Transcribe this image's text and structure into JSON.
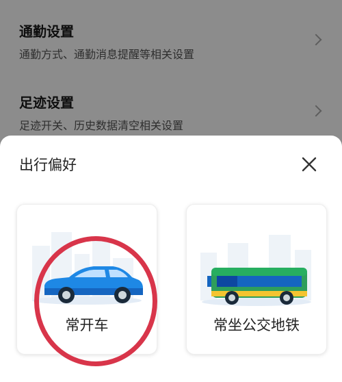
{
  "settings": [
    {
      "title": "通勤设置",
      "desc": "通勤方式、通勤消息提醒等相关设置"
    },
    {
      "title": "足迹设置",
      "desc": "足迹开关、历史数据清空相关设置"
    }
  ],
  "sheet": {
    "title": "出行偏好",
    "options": [
      {
        "label": "常开车",
        "icon": "car-icon"
      },
      {
        "label": "常坐公交地铁",
        "icon": "bus-icon"
      }
    ]
  },
  "colors": {
    "highlight": "#d8354a",
    "car_blue": "#1e88e5",
    "bus_green": "#2e9e5b",
    "bus_blue": "#1565c0"
  }
}
